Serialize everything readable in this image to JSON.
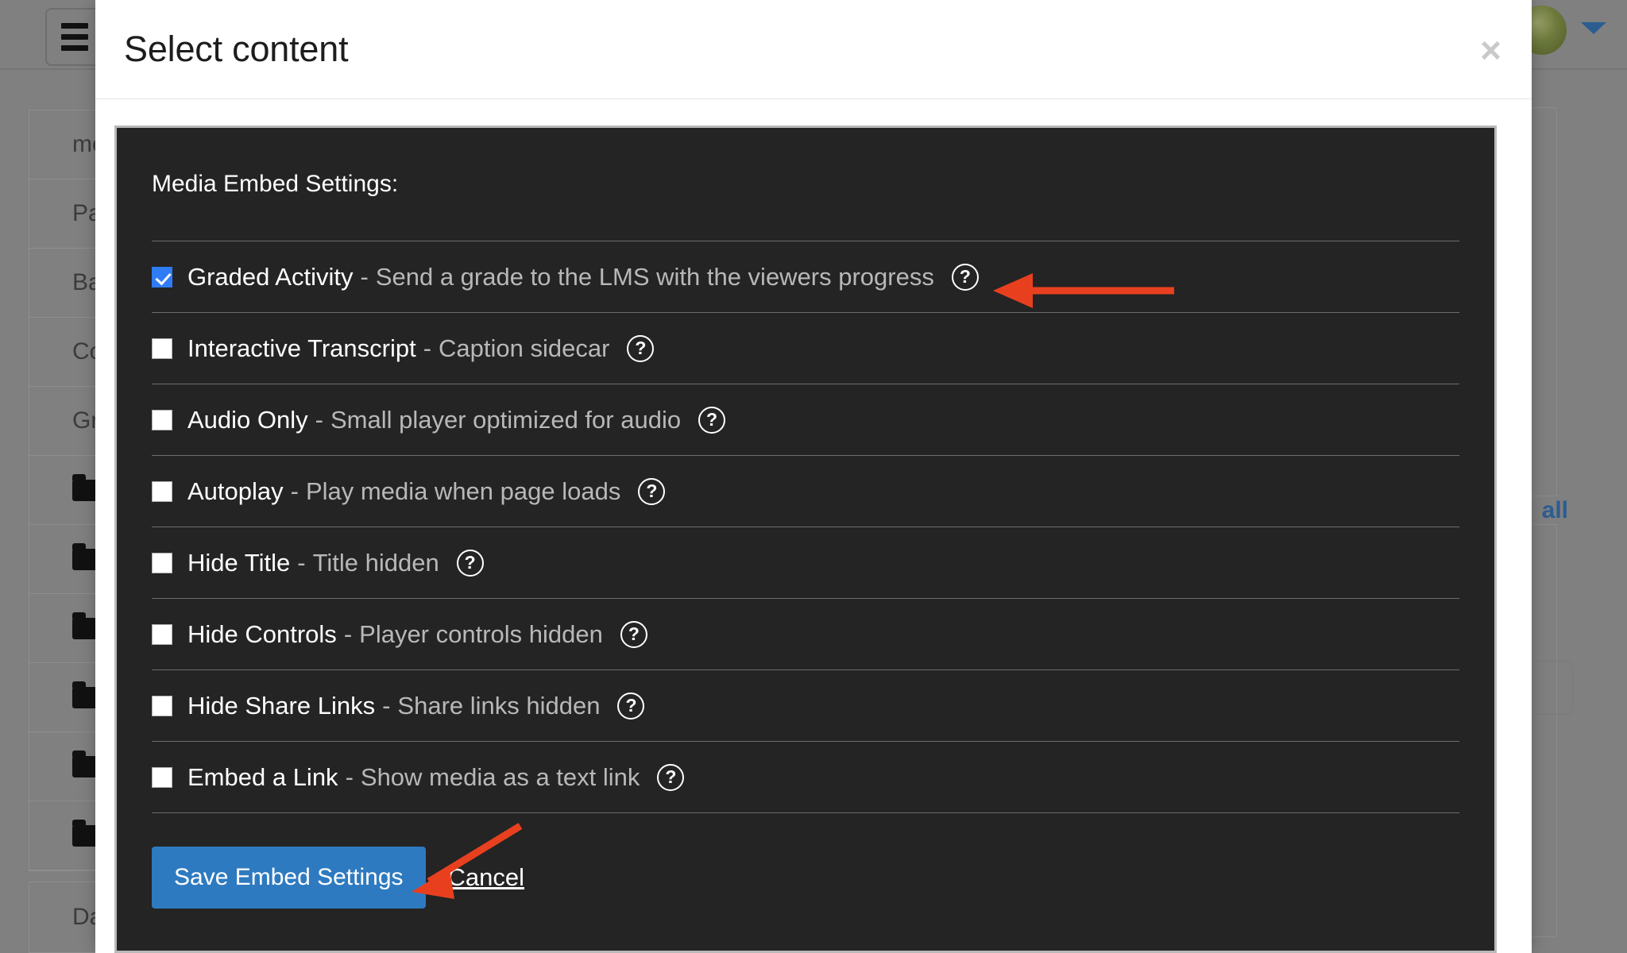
{
  "background": {
    "hamburger_icon": "hamburger-menu-icon",
    "avatar_icon": "user-avatar",
    "caret_icon": "chevron-down-icon",
    "list_items": [
      {
        "label": "mod",
        "icon": null
      },
      {
        "label": "Part",
        "icon": null
      },
      {
        "label": "Bad",
        "icon": null
      },
      {
        "label": "Com",
        "icon": null
      },
      {
        "label": "Grad",
        "icon": null
      },
      {
        "label": "",
        "icon": "folder-icon"
      },
      {
        "label": "",
        "icon": "folder-icon"
      },
      {
        "label": "",
        "icon": "folder-icon"
      },
      {
        "label": "",
        "icon": "folder-icon"
      },
      {
        "label": "",
        "icon": "folder-icon"
      },
      {
        "label": "",
        "icon": "folder-icon"
      }
    ],
    "bottom_item": "Das",
    "all_link": "all"
  },
  "modal": {
    "title": "Select content",
    "close_label": "×",
    "panel": {
      "heading": "Media Embed Settings:",
      "options": [
        {
          "label": "Graded Activity",
          "separator": "-",
          "description": "Send a grade to the LMS with the viewers progress",
          "checked": true,
          "help_icon": "help-circle-icon"
        },
        {
          "label": "Interactive Transcript",
          "separator": "-",
          "description": "Caption sidecar",
          "checked": false,
          "help_icon": "help-circle-icon"
        },
        {
          "label": "Audio Only",
          "separator": "-",
          "description": "Small player optimized for audio",
          "checked": false,
          "help_icon": "help-circle-icon"
        },
        {
          "label": "Autoplay",
          "separator": "-",
          "description": "Play media when page loads",
          "checked": false,
          "help_icon": "help-circle-icon"
        },
        {
          "label": "Hide Title",
          "separator": "-",
          "description": "Title hidden",
          "checked": false,
          "help_icon": "help-circle-icon"
        },
        {
          "label": "Hide Controls",
          "separator": "-",
          "description": "Player controls hidden",
          "checked": false,
          "help_icon": "help-circle-icon"
        },
        {
          "label": "Hide Share Links",
          "separator": "-",
          "description": "Share links hidden",
          "checked": false,
          "help_icon": "help-circle-icon"
        },
        {
          "label": "Embed a Link",
          "separator": "-",
          "description": "Show media as a text link",
          "checked": false,
          "help_icon": "help-circle-icon"
        }
      ],
      "save_label": "Save Embed Settings",
      "cancel_label": "Cancel"
    }
  },
  "annotations": {
    "arrow_color": "#e8401f",
    "arrows": [
      {
        "name": "arrow-to-graded-activity-help"
      },
      {
        "name": "arrow-to-save-button"
      }
    ]
  },
  "colors": {
    "accent_blue": "#2e7ac0",
    "checkbox_blue": "#2f7cf6",
    "panel_bg": "#242424",
    "annotation_red": "#e8401f",
    "link_blue": "#2c5d91"
  }
}
